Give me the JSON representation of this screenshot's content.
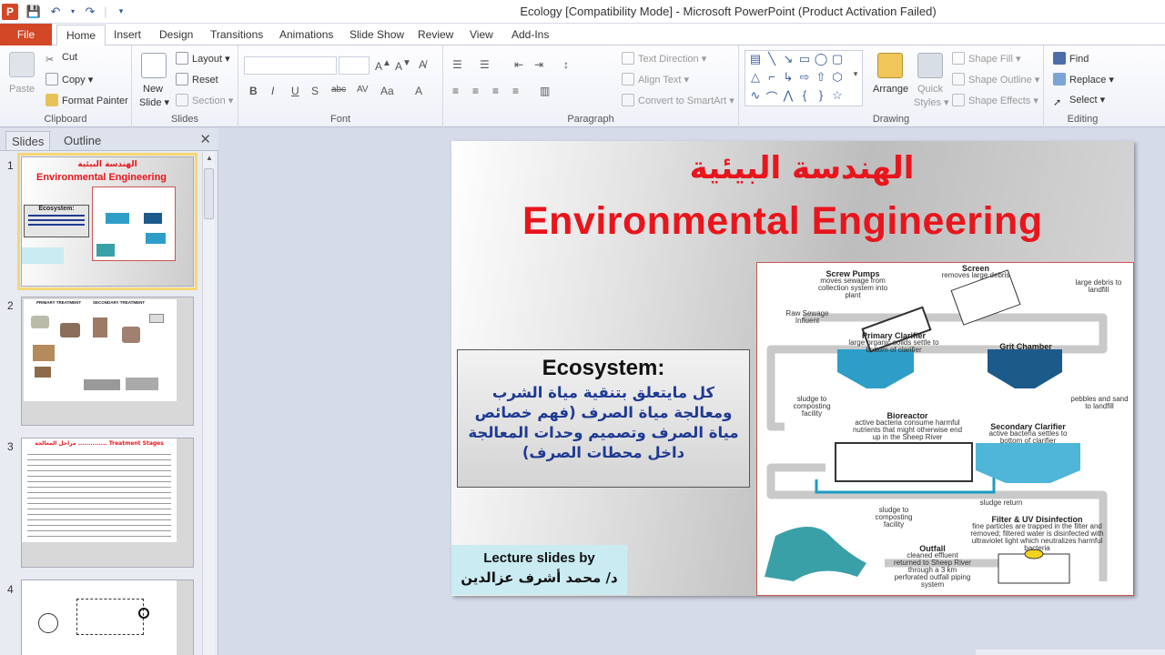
{
  "window": {
    "title": "Ecology [Compatibility Mode]  -  Microsoft PowerPoint (Product Activation Failed)",
    "app_icon": "P"
  },
  "tabs": {
    "file": "File",
    "items": [
      "Home",
      "Insert",
      "Design",
      "Transitions",
      "Animations",
      "Slide Show",
      "Review",
      "View",
      "Add-Ins"
    ]
  },
  "ribbon": {
    "clipboard": {
      "label": "Clipboard",
      "paste": "Paste",
      "cut": "Cut",
      "copy": "Copy",
      "format_painter": "Format Painter"
    },
    "slides": {
      "label": "Slides",
      "new_slide_1": "New",
      "new_slide_2": "Slide",
      "layout": "Layout",
      "reset": "Reset",
      "section": "Section"
    },
    "font": {
      "label": "Font"
    },
    "paragraph": {
      "label": "Paragraph",
      "text_direction": "Text Direction",
      "align_text": "Align Text",
      "convert": "Convert to SmartArt"
    },
    "drawing": {
      "label": "Drawing",
      "arrange": "Arrange",
      "quick_styles_1": "Quick",
      "quick_styles_2": "Styles",
      "shape_fill": "Shape Fill",
      "shape_outline": "Shape Outline",
      "shape_effects": "Shape Effects"
    },
    "editing": {
      "label": "Editing",
      "find": "Find",
      "replace": "Replace",
      "select": "Select"
    }
  },
  "panel": {
    "tab_slides": "Slides",
    "tab_outline": "Outline",
    "thumbs": [
      {
        "num": "1",
        "title_ar": "الهندسة البيئية",
        "title_en": "Environmental Engineering",
        "eco": "Ecosystem:"
      },
      {
        "num": "2",
        "primary": "PRIMARY TREATMENT",
        "secondary": "SECONDARY TREATMENT"
      },
      {
        "num": "3",
        "title": "مراحل المعالجة .............. Treatment Stages"
      },
      {
        "num": "4"
      }
    ]
  },
  "slide": {
    "title_ar": "الهندسة البيئية",
    "title_en": "Environmental Engineering",
    "eco_title": "Ecosystem:",
    "eco_body": "كل مايتعلق بتنقية مياة الشرب ومعالجة مياة الصرف (فهم خصائص مياة الصرف وتصميم وحدات المعالجة داخل محطات الصرف)",
    "lecture_line1": "Lecture slides by",
    "lecture_line2": "د/ محمد أشرف عزالدين",
    "diagram": {
      "screw_pumps": "Screw Pumps",
      "screw_pumps_desc": "moves sewage from collection system into plant",
      "screen": "Screen",
      "screen_desc": "removes large debris",
      "large_debris": "large debris to landfill",
      "raw_sewage": "Raw Sewage Influent",
      "primary_clarifier": "Primary Clarifier",
      "primary_desc": "large organic solids settle to bottom of clarifier",
      "grit_chamber": "Grit Chamber",
      "sludge_composting_1": "sludge to composting facility",
      "pebbles": "pebbles and sand to landfill",
      "bioreactor": "Bioreactor",
      "bioreactor_desc": "active bacteria consume harmful nutrients that might otherwise end up in the Sheep River",
      "secondary_clarifier": "Secondary Clarifier",
      "secondary_desc": "active bacteria settles to bottom of clarifier",
      "sludge_return": "sludge return",
      "sludge_composting_2": "sludge to composting facility",
      "filter_uv": "Filter & UV Disinfection",
      "filter_desc": "fine particles are trapped in the filter and removed; filtered water is disinfected with ultraviolet light which neutralizes harmful bacteria",
      "outfall": "Outfall",
      "outfall_desc": "cleaned effluent returned to Sheep River through a 3 km perforated outfall piping system"
    }
  },
  "colors": {
    "file_tab": "#d24726",
    "title_red": "#e8151c",
    "eco_blue": "#1f3a93",
    "lecture_bg": "#c9ebf1",
    "clarifier_blue": "#2e9ec9",
    "grit_blue": "#1c5a8a"
  }
}
